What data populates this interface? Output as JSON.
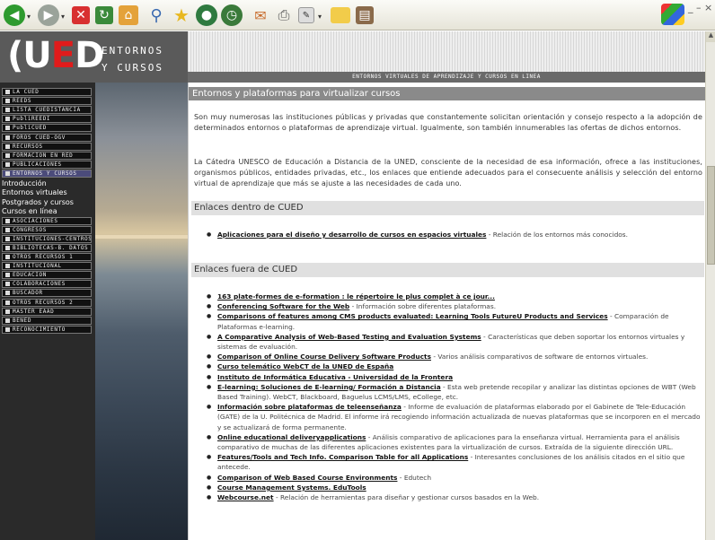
{
  "browser": {
    "toolbar_icons": [
      "back-icon",
      "forward-icon",
      "stop-icon",
      "refresh-icon",
      "home-icon",
      "search-icon",
      "favorites-icon",
      "media-icon",
      "history-icon",
      "mail-icon",
      "print-icon",
      "edit-icon",
      "folder-icon",
      "research-icon"
    ],
    "window_controls": "_ – ×"
  },
  "site": {
    "logo_letters": {
      "a": "(U",
      "b": "E",
      "c": "D"
    },
    "logo_side_lines": [
      "ENTORNOS",
      "Y CURSOS"
    ],
    "tagline": "ENTORNOS VIRTUALES DE APRENDIZAJE Y CURSOS EN LINEA"
  },
  "sidebar": {
    "items_top": [
      "LA CUED",
      "REEDS",
      "LISTA CUEDISTANCIA",
      "PubliREEDI",
      "PubliCUED",
      "FOROS CUED-OGV",
      "RECURSOS",
      "FORMACION EN RED",
      "PUBLICACIONES",
      "ENTORNOS Y CURSOS"
    ],
    "subitems": [
      "Introducción",
      "Entornos virtuales",
      "Postgrados y cursos",
      "Cursos en línea"
    ],
    "items_bottom": [
      "ASOCIACIONES",
      "CONGRESOS",
      "INSTITUCIONES-CENTROS",
      "BIBLIOTECAS-B. DATOS",
      "OTROS RECURSOS 1",
      "INSTITUCIONAL",
      "EDUCACION",
      "COLABORACIONES",
      "BUSCADOR",
      "OTROS RECURSOS 2",
      "MASTER EAAD",
      "BENED",
      "RECONOCIMIENTO"
    ]
  },
  "main": {
    "title": "Entornos y plataformas para virtualizar cursos",
    "para1": "Son muy numerosas las instituciones públicas y privadas que constantemente solicitan orientación y consejo respecto a la adopción de determinados entornos o plataformas de aprendizaje virtual. Igualmente, son también innumerables las ofertas de dichos entornos.",
    "para2": "La Cátedra UNESCO de Educación a Distancia de la UNED, consciente de la necesidad de esa información, ofrece a las instituciones, organismos públicos, entidades privadas, etc., los enlaces que entiende adecuados para el consecuente análisis y selección del entorno virtual de aprendizaje que más se ajuste a las necesidades de cada uno.",
    "section1": "Enlaces dentro de CUED",
    "links_in": [
      {
        "title": "Aplicaciones para el diseño y desarrollo de cursos en espacios virtuales",
        "desc": " - Relación de los entornos más conocidos."
      }
    ],
    "section2": "Enlaces fuera de CUED",
    "links_out": [
      {
        "title": "163 plate-formes de e-formation : le répertoire le plus complet à ce jour...",
        "desc": ""
      },
      {
        "title": "Conferencing Software for the Web",
        "desc": " - Información sobre diferentes plataformas."
      },
      {
        "title": "Comparisons of features among CMS products evaluated: Learning Tools FutureU Products and Services",
        "desc": " - Comparación de Plataformas e-learning."
      },
      {
        "title": "A Comparative Analysis of Web-Based Testing and Evaluation Systems",
        "desc": " - Características que deben soportar los entornos virtuales y sistemas de evaluación."
      },
      {
        "title": "Comparison of Online Course Delivery Software Products",
        "desc": " - Varios análisis comparativos de software de entornos virtuales."
      },
      {
        "title": "Curso telemático WebCT de la UNED de España",
        "desc": ""
      },
      {
        "title": "Instituto de Informática Educativa - Universidad de la Frontera",
        "desc": ""
      },
      {
        "title": "E-learning: Soluciones de E-learning/ Formación a Distancia",
        "desc": " - Esta web pretende recopilar y analizar las distintas opciones de WBT (Web Based Training). WebCT, Blackboard, Baguelus LCMS/LMS, eCollege, etc."
      },
      {
        "title": "Información sobre plataformas de teleenseñanza",
        "desc": " - Informe de evaluación de plataformas elaborado por el Gabinete de Tele-Educación (GATE) de la U. Politécnica de Madrid. El informe irá recogiendo información actualizada de nuevas plataformas que se incorporen en el mercado y se actualizará de forma permanente."
      },
      {
        "title": "Online educational deliveryapplications",
        "desc": " - Análisis comparativo de aplicaciones para la enseñanza virtual. Herramienta para el análisis comparativo de muchas de las diferentes aplicaciones existentes para la virtualización de cursos. Extraída de la siguiente dirección URL."
      },
      {
        "title": "Features/Tools and Tech Info. Comparison Table for all Applications",
        "desc": " - Interesantes conclusiones de los análisis citados en el sitio que antecede."
      },
      {
        "title": "Comparison of Web Based Course Environments",
        "desc": " - Edutech"
      },
      {
        "title": "Course Management Systems. EduTools",
        "desc": ""
      },
      {
        "title": "Webcourse.net",
        "desc": " - Relación de herramientas para diseñar y gestionar cursos basados en la Web."
      }
    ]
  }
}
